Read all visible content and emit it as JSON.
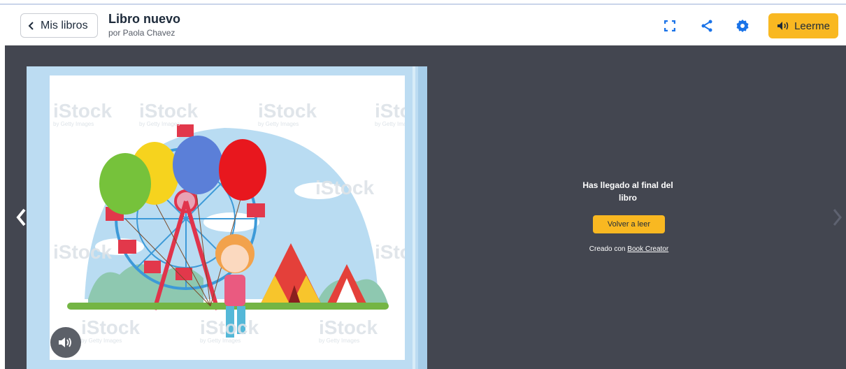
{
  "header": {
    "back_label": "Mis libros",
    "title": "Libro nuevo",
    "author": "por Paola Chavez",
    "fullscreen_icon": "fullscreen-icon",
    "share_icon": "share-icon",
    "settings_icon": "gear-icon",
    "read_label": "Leerme"
  },
  "viewer": {
    "end_message": "Has llegado al final del libro",
    "reread_label": "Volver a leer",
    "credit_prefix": "Creado con ",
    "credit_link": "Book Creator",
    "watermark": "iStock",
    "watermark_sub": "by Getty Images"
  },
  "colors": {
    "accent": "#f9b821",
    "viewer_bg": "#434650",
    "icon_blue": "#1a73e8",
    "page_bg": "#bcdcf2"
  }
}
